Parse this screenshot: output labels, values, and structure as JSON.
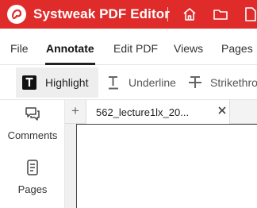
{
  "app": {
    "title": "Systweak PDF Editor",
    "brand_color": "#e02b2b",
    "logo_icon": "pdf-logo-icon",
    "title_icons": [
      "home-icon",
      "folder-icon",
      "document-icon"
    ]
  },
  "menu": {
    "items": [
      {
        "label": "File"
      },
      {
        "label": "Annotate",
        "active": true
      },
      {
        "label": "Edit PDF"
      },
      {
        "label": "Views"
      },
      {
        "label": "Pages"
      }
    ]
  },
  "toolbar": {
    "tools": [
      {
        "label": "Highlight",
        "icon": "highlight-icon",
        "selected": true
      },
      {
        "label": "Underline",
        "icon": "underline-icon"
      },
      {
        "label": "Strikethro",
        "icon": "strikethrough-icon"
      }
    ]
  },
  "sidebar": {
    "items": [
      {
        "label": "Comments",
        "icon": "comments-icon"
      },
      {
        "label": "Pages",
        "icon": "pages-icon"
      }
    ]
  },
  "tabs": {
    "add_label": "+",
    "items": [
      {
        "label": "562_lecture1lx_20...",
        "close_icon": "close-icon"
      }
    ]
  }
}
